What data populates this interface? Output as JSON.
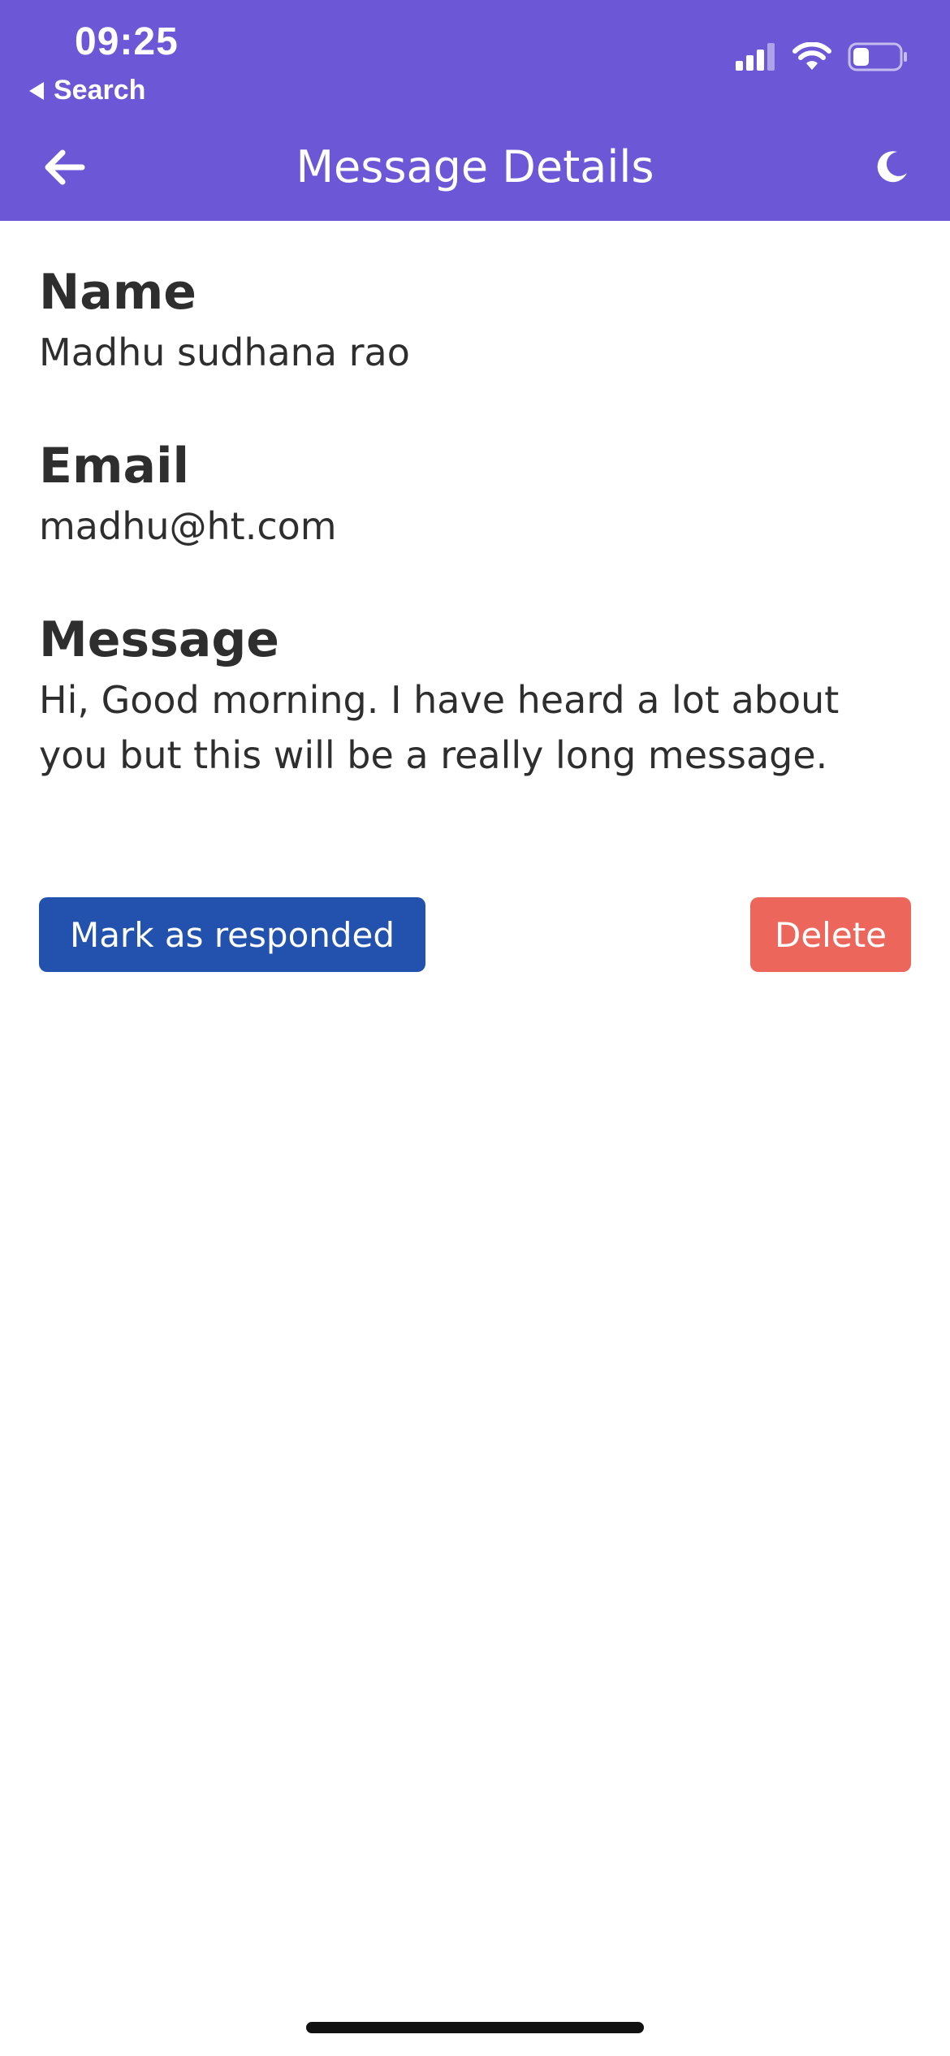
{
  "status_bar": {
    "time": "09:25",
    "back_app_label": "Search",
    "icons": [
      "cellular-signal-icon",
      "wifi-icon",
      "battery-icon"
    ]
  },
  "app_bar": {
    "title": "Message Details",
    "back_icon": "arrow-left-icon",
    "theme_icon": "moon-icon",
    "background_color": "#6c58d6"
  },
  "details": {
    "name_label": "Name",
    "name_value": "Madhu sudhana rao",
    "email_label": "Email",
    "email_value": "madhu@ht.com",
    "message_label": "Message",
    "message_value": "Hi, Good morning. I have heard a lot about you but this will be a really long message."
  },
  "actions": {
    "responded_label": "Mark as responded",
    "responded_color": "#2352ae",
    "delete_label": "Delete",
    "delete_color": "#ec665c"
  },
  "battery_level": 0.35
}
